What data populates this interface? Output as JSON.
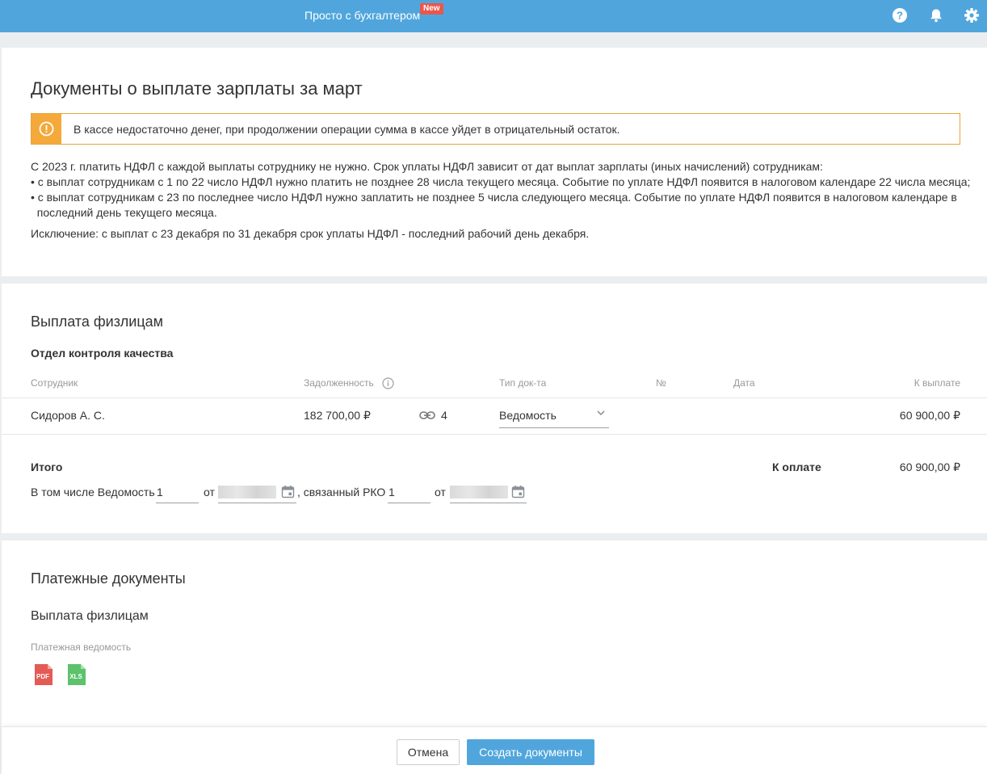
{
  "topbar": {
    "promo_label": "Просто с бухгалтером",
    "promo_badge": "New",
    "icons": [
      "help-icon",
      "bell-icon",
      "gear-icon"
    ],
    "accent": "#50a6dc"
  },
  "page": {
    "title": "Документы о выплате зарплаты за март",
    "warning": "В кассе недостаточно денег, при продолжении операции сумма в кассе уйдет в отрицательный остаток.",
    "info_lines": [
      "С 2023 г. платить НДФЛ с каждой выплаты сотруднику не нужно. Срок уплаты НДФЛ зависит от дат выплат зарплаты (иных начислений) сотрудникам:",
      "• с выплат сотрудникам с 1 по 22 число НДФЛ нужно платить не позднее 28 числа текущего месяца. Событие по уплате НДФЛ появится в налоговом календаре 22 числа месяца;",
      "• с выплат сотрудникам с 23 по последнее число НДФЛ нужно заплатить не позднее 5 числа следующего месяца. Событие по уплате НДФЛ появится в налоговом календаре в",
      "  последний день текущего месяца."
    ],
    "exception": "Исключение: с выплат с 23 декабря по 31 декабря срок уплаты НДФЛ - последний рабочий день декабря."
  },
  "payout": {
    "title": "Выплата физлицам",
    "department": "Отдел контроля качества",
    "columns": {
      "employee": "Сотрудник",
      "debt": "Задолженность",
      "doc_type": "Тип док-та",
      "number": "№",
      "date": "Дата",
      "to_pay": "К выплате"
    },
    "rows": [
      {
        "employee": "Сидоров А. С.",
        "debt": "182 700,00 ₽",
        "link_count": "4",
        "doc_type": "Ведомость",
        "to_pay": "60 900,00 ₽"
      }
    ],
    "total_label": "Итого",
    "to_pay_label": "К оплате",
    "to_pay_value": "60 900,00 ₽",
    "incl_label": "В том числе Ведомость",
    "statement_number": "1",
    "from_label": "от",
    "rko_label": ", связанный РКО",
    "rko_number": "1",
    "from_label2": "от"
  },
  "payment_docs": {
    "title": "Платежные документы",
    "subtitle": "Выплата физлицам",
    "doc_name": "Платежная ведомость",
    "pdf_label": "PDF",
    "xls_label": "XLS"
  },
  "footer": {
    "cancel": "Отмена",
    "create": "Создать документы"
  }
}
